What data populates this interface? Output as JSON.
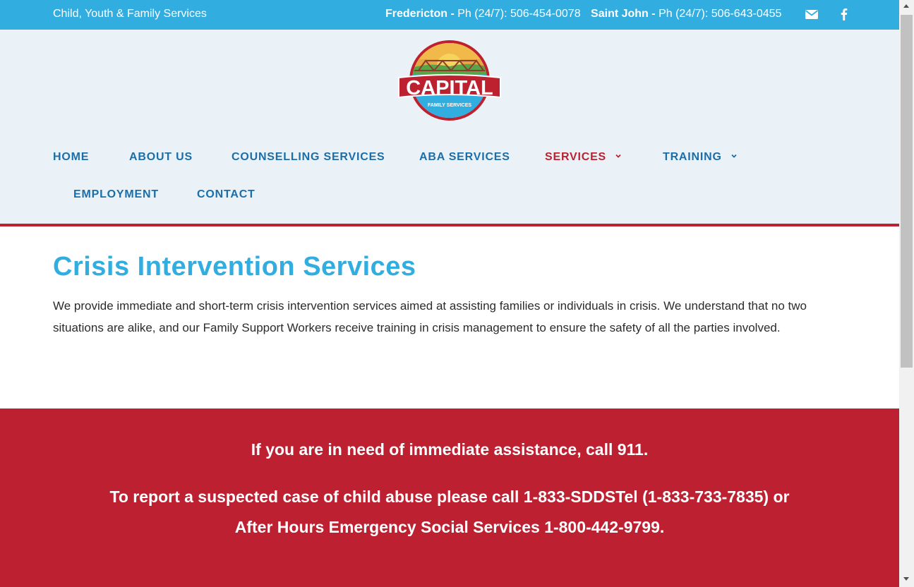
{
  "topbar": {
    "tagline": "Child, Youth & Family Services",
    "phone1_city": "Fredericton -",
    "phone1_text": "Ph (24/7): 506-454-0078",
    "phone2_city": "Saint John -",
    "phone2_text": "Ph (24/7): 506-643-0455",
    "icons": [
      "envelope-icon",
      "facebook-icon"
    ]
  },
  "logo": {
    "name": "CAPITAL",
    "sub": "FAMILY SERVICES"
  },
  "nav": {
    "items": [
      {
        "label": "HOME"
      },
      {
        "label": "ABOUT US"
      },
      {
        "label": "COUNSELLING SERVICES"
      },
      {
        "label": "ABA SERVICES"
      },
      {
        "label": "SERVICES",
        "active": true,
        "dropdown": true
      },
      {
        "label": "TRAINING",
        "dropdown": true
      },
      {
        "label": "EMPLOYMENT"
      },
      {
        "label": "CONTACT"
      }
    ]
  },
  "main": {
    "title": "Crisis Intervention Services",
    "body": "We provide immediate and short-term crisis intervention services aimed at assisting families or individuals in crisis. We understand that no two situations are alike, and our Family Support Workers receive training in crisis management to ensure the safety of all the parties involved."
  },
  "alert": {
    "line1": "If you are in need of immediate assistance, call 911.",
    "line2": "To report a suspected case of child abuse please call 1-833-SDDSTel (1-833-733-7835) or",
    "line3": "After Hours Emergency Social Services 1-800-442-9799."
  },
  "colors": {
    "topbar": "#31ade0",
    "header_bg": "#eaf2f7",
    "nav": "#1b6ea9",
    "accent_red": "#bd2130",
    "title": "#31ade0"
  }
}
